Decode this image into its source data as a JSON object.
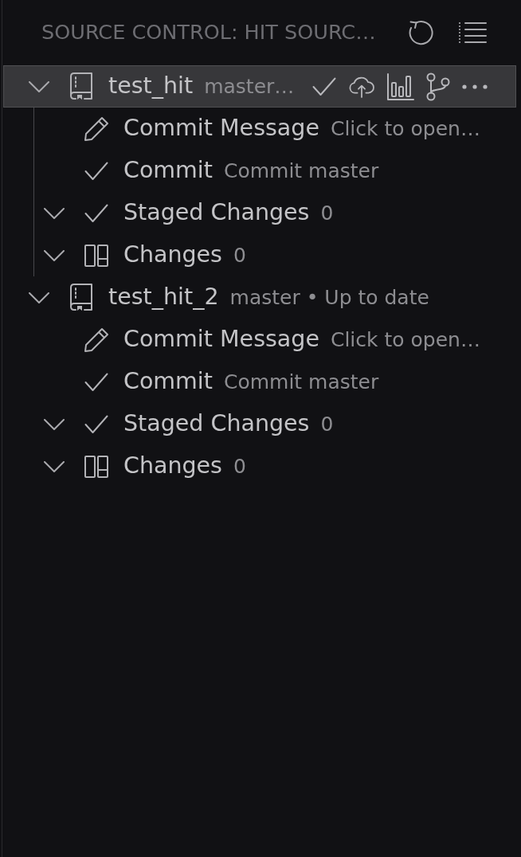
{
  "header": {
    "title": "SOURCE CONTROL: HIT SOURC…"
  },
  "repositories": [
    {
      "name": "test_hit",
      "description": "master…",
      "selected": true,
      "expanded": true,
      "children": [
        {
          "kind": "message",
          "label": "Commit Message",
          "description": "Click to open…"
        },
        {
          "kind": "commit",
          "label": "Commit",
          "description": "Commit master"
        },
        {
          "kind": "staged",
          "label": "Staged Changes",
          "count": "0",
          "expanded": true
        },
        {
          "kind": "changes",
          "label": "Changes",
          "count": "0",
          "expanded": true
        }
      ]
    },
    {
      "name": "test_hit_2",
      "description": "master • Up to date",
      "selected": false,
      "expanded": true,
      "children": [
        {
          "kind": "message",
          "label": "Commit Message",
          "description": "Click to open…"
        },
        {
          "kind": "commit",
          "label": "Commit",
          "description": "Commit master"
        },
        {
          "kind": "staged",
          "label": "Staged Changes",
          "count": "0",
          "expanded": true
        },
        {
          "kind": "changes",
          "label": "Changes",
          "count": "0",
          "expanded": true
        }
      ]
    }
  ]
}
